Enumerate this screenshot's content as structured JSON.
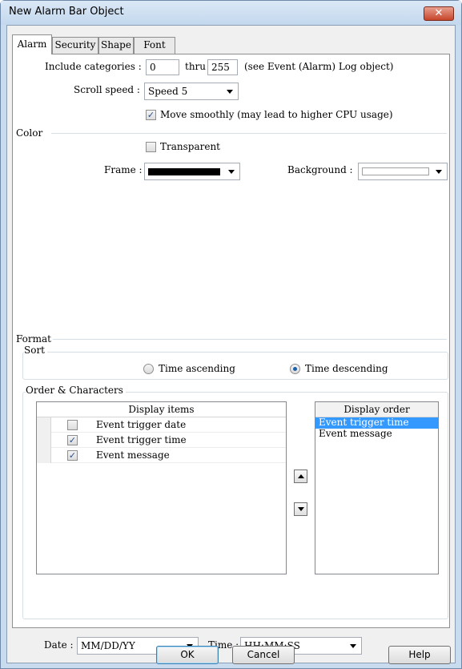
{
  "window": {
    "title": "New Alarm Bar Object",
    "close_glyph": "✕"
  },
  "tabs": [
    {
      "label": "Alarm"
    },
    {
      "label": "Security"
    },
    {
      "label": "Shape"
    },
    {
      "label": "Font"
    }
  ],
  "alarm": {
    "include_label": "Include categories :",
    "from_value": "0",
    "thru_label": "thru",
    "to_value": "255",
    "hint": "(see Event (Alarm) Log object)",
    "scroll_label": "Scroll  speed :",
    "scroll_value": "Speed 5",
    "smooth_label": "Move smoothly (may lead to higher CPU usage)",
    "smooth_checked": true
  },
  "color": {
    "heading": "Color",
    "transparent_label": "Transparent",
    "transparent_checked": false,
    "frame_label": "Frame :",
    "frame_color": "#000000",
    "background_label": "Background :",
    "background_color": "#ffffff"
  },
  "format": {
    "heading": "Format",
    "sort_heading": "Sort",
    "sort_asc_label": "Time ascending",
    "sort_desc_label": "Time descending",
    "sort_selected": "descending",
    "order_heading": "Order & Characters",
    "display_items_header": "Display items",
    "display_items": [
      {
        "label": "Event trigger date",
        "checked": false
      },
      {
        "label": "Event trigger time",
        "checked": true
      },
      {
        "label": "Event message",
        "checked": true
      }
    ],
    "display_order_header": "Display order",
    "display_order": [
      {
        "label": "Event trigger time",
        "selected": true
      },
      {
        "label": "Event message",
        "selected": false
      }
    ],
    "date_label": "Date :",
    "date_value": "MM/DD/YY",
    "time_label": "Time :",
    "time_value": "HH:MM:SS"
  },
  "buttons": {
    "ok": "OK",
    "cancel": "Cancel",
    "help": "Help"
  },
  "colors": {
    "selection": "#3399ff",
    "title_bg": "#c9dcef",
    "close_red": "#c7452b"
  },
  "icons": {
    "up": "triangle-up-icon",
    "down": "triangle-down-icon",
    "check": "check-icon"
  }
}
